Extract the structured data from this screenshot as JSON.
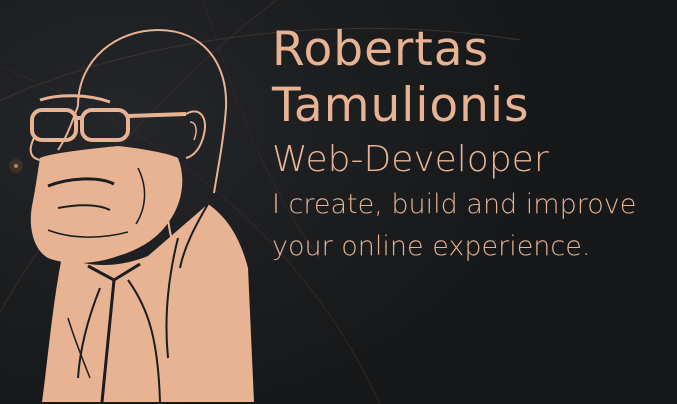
{
  "hero": {
    "name_line_1": "Robertas",
    "name_line_2": "Tamulionis",
    "role": "Web-Developer",
    "tagline_line_1": "I create, build and improve",
    "tagline_line_2": "your online experience."
  },
  "colors": {
    "background": "#1a1c1e",
    "accent": "#e7b393",
    "line": "#3a3530"
  },
  "icons": {
    "portrait": "bearded-man-with-glasses-illustration"
  }
}
